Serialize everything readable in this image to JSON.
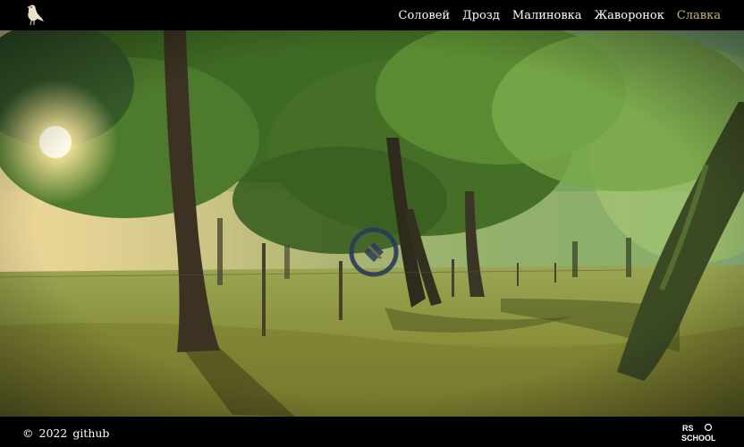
{
  "header": {
    "logo_icon": "bird-icon",
    "nav": [
      {
        "label": "Соловей",
        "active": false
      },
      {
        "label": "Дрозд",
        "active": false
      },
      {
        "label": "Малиновка",
        "active": false
      },
      {
        "label": "Жаворонок",
        "active": false
      },
      {
        "label": "Славка",
        "active": true
      }
    ],
    "active_color": "#c9b27a"
  },
  "main": {
    "background": "sunlit-forest-image",
    "play_button_icon": "play-pause-icon"
  },
  "footer": {
    "copyright_symbol": "©",
    "year": "2022",
    "link": "github",
    "school_logo_text_top": "RS",
    "school_logo_text_bottom": "SCHOOL"
  }
}
